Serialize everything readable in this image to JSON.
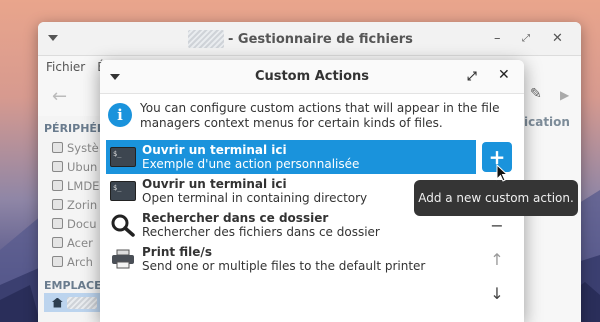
{
  "fm_window": {
    "title": "- Gestionnaire de fichiers",
    "menu": [
      "Fichier",
      "É"
    ],
    "column_header": "ication",
    "sidebar": {
      "heading_devices": "PÉRIPHÉR",
      "devices": [
        "Systè",
        "Ubun",
        "LMDE",
        "Zorin",
        "Docu",
        "Acer",
        "Arch"
      ],
      "heading_places": "EMPLACE"
    }
  },
  "dialog": {
    "title": "Custom Actions",
    "info_text": "You can configure custom actions that will appear in the file managers context menus for certain kinds of files.",
    "actions": [
      {
        "name": "Ouvrir un terminal ici",
        "description": "Exemple d'une action personnalisée",
        "icon": "terminal-icon",
        "selected": true
      },
      {
        "name": "Ouvrir un terminal ici",
        "description": "Open terminal in containing directory",
        "icon": "terminal-icon",
        "selected": false
      },
      {
        "name": "Rechercher dans ce dossier",
        "description": "Rechercher des fichiers dans ce dossier",
        "icon": "search-icon",
        "selected": false
      },
      {
        "name": "Print file/s",
        "description": "Send one or multiple files to the default printer",
        "icon": "printer-icon",
        "selected": false
      }
    ],
    "buttons": {
      "add": "+",
      "remove": "−"
    },
    "tooltip": "Add a new custom action."
  },
  "colors": {
    "accent": "#1a93dc",
    "tooltip_bg": "#353535"
  }
}
